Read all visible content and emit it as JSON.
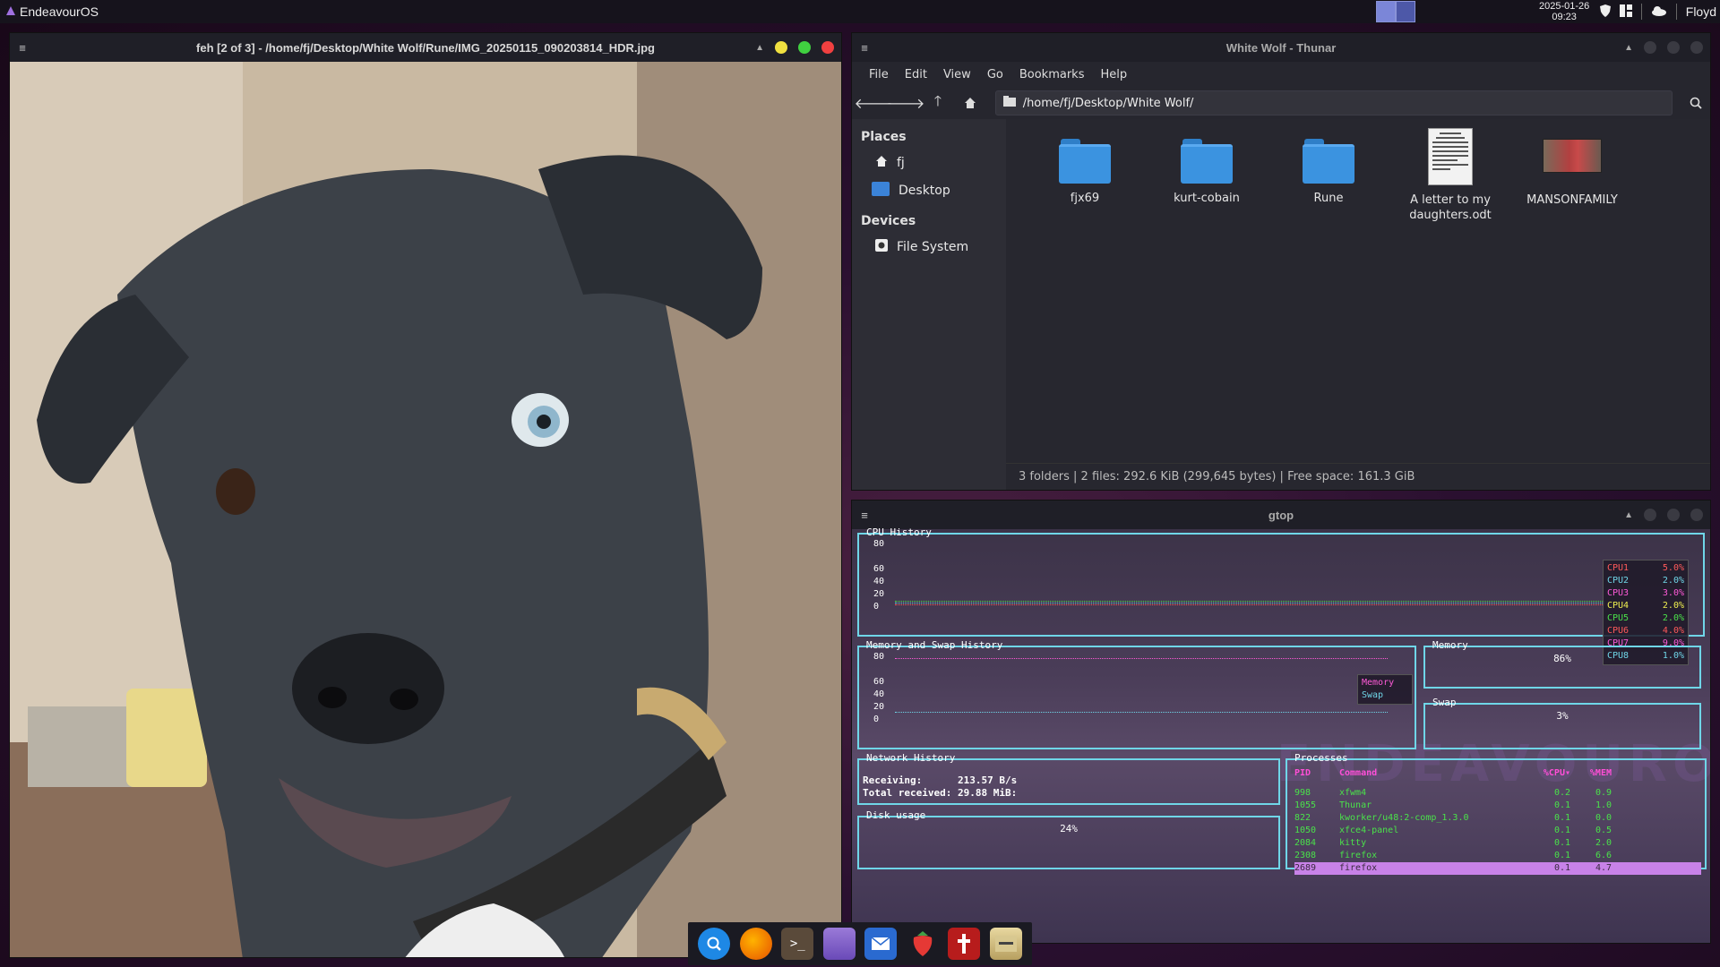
{
  "panel": {
    "app_menu_label": "EndeavourOS",
    "clock_date": "2025-01-26",
    "clock_time": "09:23",
    "username": "Floyd"
  },
  "feh": {
    "title": "feh [2 of 3] - /home/fj/Desktop/White Wolf/Rune/IMG_20250115_090203814_HDR.jpg"
  },
  "thunar": {
    "title": "White Wolf - Thunar",
    "menu": [
      "File",
      "Edit",
      "View",
      "Go",
      "Bookmarks",
      "Help"
    ],
    "path": "/home/fj/Desktop/White Wolf/",
    "places_heading": "Places",
    "places": [
      "fj",
      "Desktop"
    ],
    "devices_heading": "Devices",
    "devices": [
      "File System"
    ],
    "files": [
      {
        "name": "fjx69",
        "kind": "folder"
      },
      {
        "name": "kurt-cobain",
        "kind": "folder"
      },
      {
        "name": "Rune",
        "kind": "folder"
      },
      {
        "name": "A letter to my daughters.odt",
        "kind": "document"
      },
      {
        "name": "MANSONFAMILY",
        "kind": "image"
      }
    ],
    "status": "3 folders  |  2 files: 292.6 KiB (299,645 bytes)  |  Free space: 161.3 GiB"
  },
  "gtop": {
    "title": "gtop",
    "cpu_history_title": "CPU History",
    "y_ticks": [
      "80",
      "60",
      "40",
      "20",
      "0"
    ],
    "cpus": [
      {
        "name": "CPU1",
        "value": "5.0%",
        "color": "#ff5a5a"
      },
      {
        "name": "CPU2",
        "value": "2.0%",
        "color": "#6fd6e8"
      },
      {
        "name": "CPU3",
        "value": "3.0%",
        "color": "#ff5ad8"
      },
      {
        "name": "CPU4",
        "value": "2.0%",
        "color": "#f0f050"
      },
      {
        "name": "CPU5",
        "value": "2.0%",
        "color": "#4ae24a"
      },
      {
        "name": "CPU6",
        "value": "4.0%",
        "color": "#ff5a5a"
      },
      {
        "name": "CPU7",
        "value": "9.0%",
        "color": "#ff5ad8"
      },
      {
        "name": "CPU8",
        "value": "1.0%",
        "color": "#6fd6e8"
      }
    ],
    "mem_history_title": "Memory and Swap History",
    "mem_legend": [
      "Memory",
      "Swap"
    ],
    "memory_title": "Memory",
    "memory_value": "86%",
    "swap_title": "Swap",
    "swap_value": "3%",
    "network_title": "Network History",
    "receiving_label": "Receiving:",
    "receiving_value": "213.57  B/s",
    "total_label": "Total received:",
    "total_value": "29.88 MiB:",
    "disk_title": "Disk usage",
    "disk_value": "24%",
    "processes_title": "Processes",
    "proc_headers": [
      "PID",
      "Command",
      "%CPU▾",
      "%MEM"
    ],
    "processes": [
      [
        "998",
        "xfwm4",
        "0.2",
        "0.9"
      ],
      [
        "1055",
        "Thunar",
        "0.1",
        "1.0"
      ],
      [
        "822",
        "kworker/u48:2-comp_1.3.0",
        "0.1",
        "0.0"
      ],
      [
        "1050",
        "xfce4-panel",
        "0.1",
        "0.5"
      ],
      [
        "2084",
        "kitty",
        "0.1",
        "2.0"
      ],
      [
        "2308",
        "firefox",
        "0.1",
        "6.6"
      ],
      [
        "2689",
        "firefox",
        "0.1",
        "4.7"
      ]
    ],
    "watermark": "ENDEAVOUROS"
  },
  "dock": [
    "search",
    "firefox",
    "terminal",
    "files-manager",
    "mail",
    "strawberry",
    "bible",
    "archive"
  ]
}
